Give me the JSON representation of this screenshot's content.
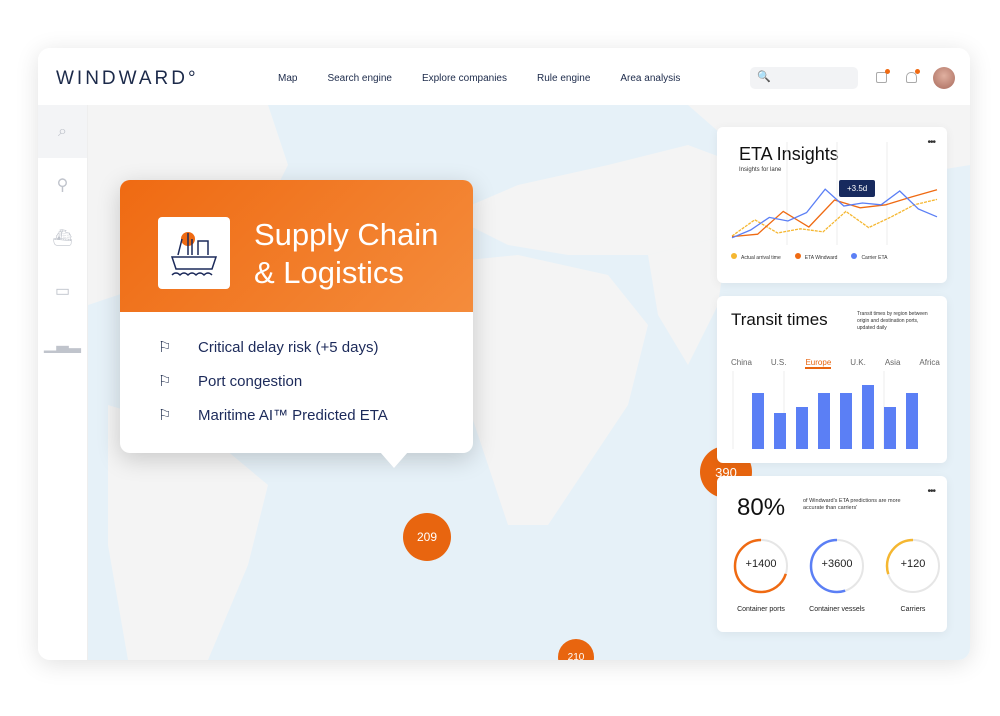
{
  "header": {
    "logo": "WINDWARD°",
    "nav": [
      "Map",
      "Search engine",
      "Explore companies",
      "Rule engine",
      "Area analysis"
    ],
    "search_placeholder": "🔍"
  },
  "sidebar": {
    "items": [
      "search-icon",
      "user-search-icon",
      "ship-icon",
      "container-icon",
      "bar-chart-icon"
    ]
  },
  "map": {
    "markers": [
      "209",
      "390",
      "210"
    ]
  },
  "popup": {
    "title_line1": "Supply Chain",
    "title_line2": "& Logistics",
    "items": [
      "Critical delay risk (+5 days)",
      "Port congestion",
      "Maritime AI™ Predicted ETA"
    ],
    "accent": "#ef6a12"
  },
  "eta": {
    "title": "ETA Insights",
    "subtitle": "Insights for lane",
    "tooltip": "+3.5d",
    "chart_data": {
      "type": "line",
      "series": [
        {
          "name": "Actual arrival time",
          "color": "#f5b731",
          "values": [
            15,
            42,
            20,
            27,
            22,
            56,
            29,
            47,
            67,
            76
          ]
        },
        {
          "name": "ETA Windward",
          "color": "#ef6a12",
          "values": [
            14,
            18,
            56,
            30,
            75,
            62,
            67,
            80,
            92
          ]
        },
        {
          "name": "Carrier ETA",
          "color": "#5b7ff5",
          "values": [
            12,
            25,
            46,
            40,
            54,
            93,
            65,
            70,
            67,
            90,
            60,
            47
          ]
        }
      ]
    }
  },
  "transit": {
    "title": "Transit times",
    "description": "Transit times by region between origin and destination ports, updated daily",
    "tabs": [
      "China",
      "U.S.",
      "Europe",
      "U.K.",
      "Asia",
      "Africa"
    ],
    "active_tab": "Europe",
    "chart_data": {
      "type": "bar",
      "values": [
        56,
        36,
        42,
        56,
        56,
        64,
        42,
        56
      ],
      "color": "#5b7ff5"
    }
  },
  "stats": {
    "percent": "80%",
    "description": "of Windward's ETA predictions are more accurate than carriers'",
    "rings": [
      {
        "value": "+1400",
        "label": "Container ports",
        "color": "#ef6a12",
        "fraction": 0.7
      },
      {
        "value": "+3600",
        "label": "Container vessels",
        "color": "#5b7ff5",
        "fraction": 0.55
      },
      {
        "value": "+120",
        "label": "Carriers",
        "color": "#f5b731",
        "fraction": 0.3
      }
    ]
  }
}
